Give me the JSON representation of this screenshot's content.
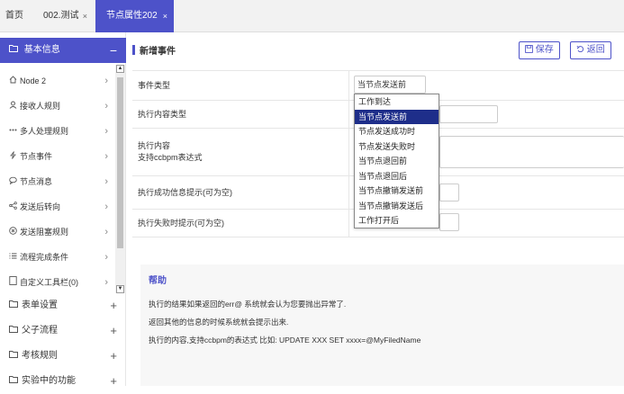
{
  "tabs": [
    {
      "label": "首页"
    },
    {
      "label": "002.测试",
      "close": "×"
    },
    {
      "label": "节点属性202",
      "close": "×"
    }
  ],
  "sidebar": {
    "header": {
      "label": "基本信息",
      "toggle": "−"
    },
    "items": [
      {
        "label": "Node 2",
        "icon": "home-icon"
      },
      {
        "label": "接收人规则",
        "icon": "user-icon"
      },
      {
        "label": "多人处理规则",
        "icon": "dots-icon"
      },
      {
        "label": "节点事件",
        "icon": "lightning-icon"
      },
      {
        "label": "节点消息",
        "icon": "message-icon"
      },
      {
        "label": "发送后转向",
        "icon": "share-icon"
      },
      {
        "label": "发送阻塞规则",
        "icon": "block-icon"
      },
      {
        "label": "流程完成条件",
        "icon": "list-icon"
      },
      {
        "label": "自定义工具栏(0)",
        "icon": "doc-icon"
      }
    ],
    "groups": [
      {
        "label": "表单设置",
        "toggle": "+"
      },
      {
        "label": "父子流程",
        "toggle": "+"
      },
      {
        "label": "考核规则",
        "toggle": "+"
      },
      {
        "label": "实验中的功能",
        "toggle": "+"
      }
    ]
  },
  "main": {
    "title": "新增事件",
    "save_label": "保存",
    "back_label": "返回",
    "form": {
      "event_type_label": "事件类型",
      "event_type_value": "当节点发送前",
      "content_type_label": "执行内容类型",
      "content_label_line1": "执行内容",
      "content_label_line2": "支持ccbpm表达式",
      "success_label": "执行成功信息提示(可为空)",
      "fail_label": "执行失败时提示(可为空)"
    },
    "dropdown_options": [
      "工作到达",
      "当节点发送前",
      "节点发送成功时",
      "节点发送失败时",
      "当节点退回前",
      "当节点退回后",
      "当节点撤销发送前",
      "当节点撤销发送后",
      "工作打开后"
    ],
    "dropdown_selected_index": 1,
    "help": {
      "title": "帮助",
      "lines": [
        "执行的结果如果返回的err@ 系统就会认为您要抛出异常了.",
        "返回其他的信息的时候系统就会提示出来.",
        "执行的内容,支持ccbpm的表达式 比如: UPDATE XXX SET xxxx=@MyFiledName"
      ]
    }
  },
  "colors": {
    "accent": "#4d52c9",
    "selected_option": "#1e2e8a"
  }
}
